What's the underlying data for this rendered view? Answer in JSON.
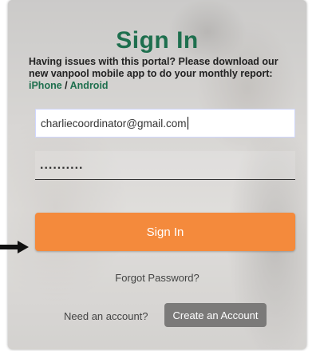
{
  "signin": {
    "title": "Sign In",
    "notice_text": "Having issues with this portal? Please download our new vanpool mobile app to do your monthly report: ",
    "iphone_link": "iPhone",
    "separator": " / ",
    "android_link": "Android",
    "email_value": "charliecoordinator@gmail.com",
    "password_value": "..........",
    "signin_button": "Sign In",
    "forgot_password": "Forgot Password?",
    "need_account": "Need an account?",
    "create_account_button": "Create an Account"
  },
  "colors": {
    "title": "#1e6f4e",
    "primary_button": "#f48a3c",
    "secondary_button": "#7b7a79"
  },
  "icons": {
    "annotation_arrow": "arrow-right-icon"
  }
}
